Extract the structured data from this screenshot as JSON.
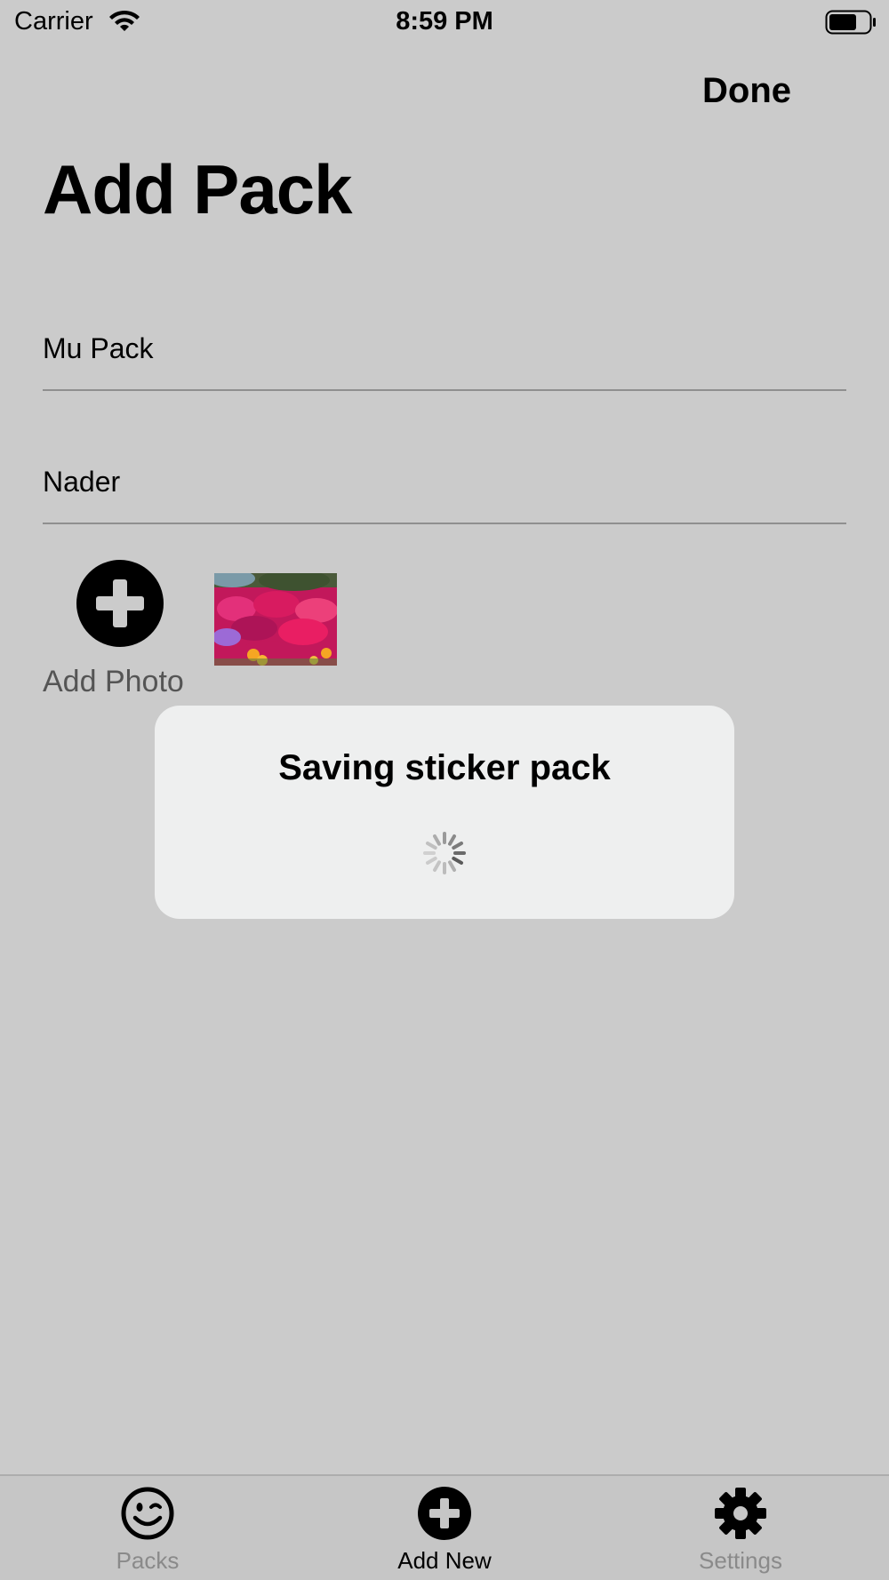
{
  "status_bar": {
    "carrier": "Carrier",
    "time": "8:59 PM"
  },
  "nav": {
    "done_label": "Done",
    "title": "Add Pack"
  },
  "form": {
    "pack_name": {
      "value": "Mu Pack",
      "placeholder": ""
    },
    "author_name": {
      "value": "Nader",
      "placeholder": ""
    }
  },
  "photos": {
    "add_label": "Add Photo",
    "icon": "plus-circle-icon"
  },
  "alert": {
    "title": "Saving sticker pack",
    "icon": "spinner-icon"
  },
  "tab_bar": {
    "tabs": [
      {
        "label": "Packs",
        "icon": "smiley-wink-icon",
        "selected": false
      },
      {
        "label": "Add New",
        "icon": "plus-circle-icon",
        "selected": true
      },
      {
        "label": "Settings",
        "icon": "gear-icon",
        "selected": false
      }
    ]
  },
  "colors": {
    "background": "#cbcbcb",
    "alert_bg": "#eeefef",
    "tab_inactive": "#8a8a8a",
    "tab_active": "#000000"
  }
}
